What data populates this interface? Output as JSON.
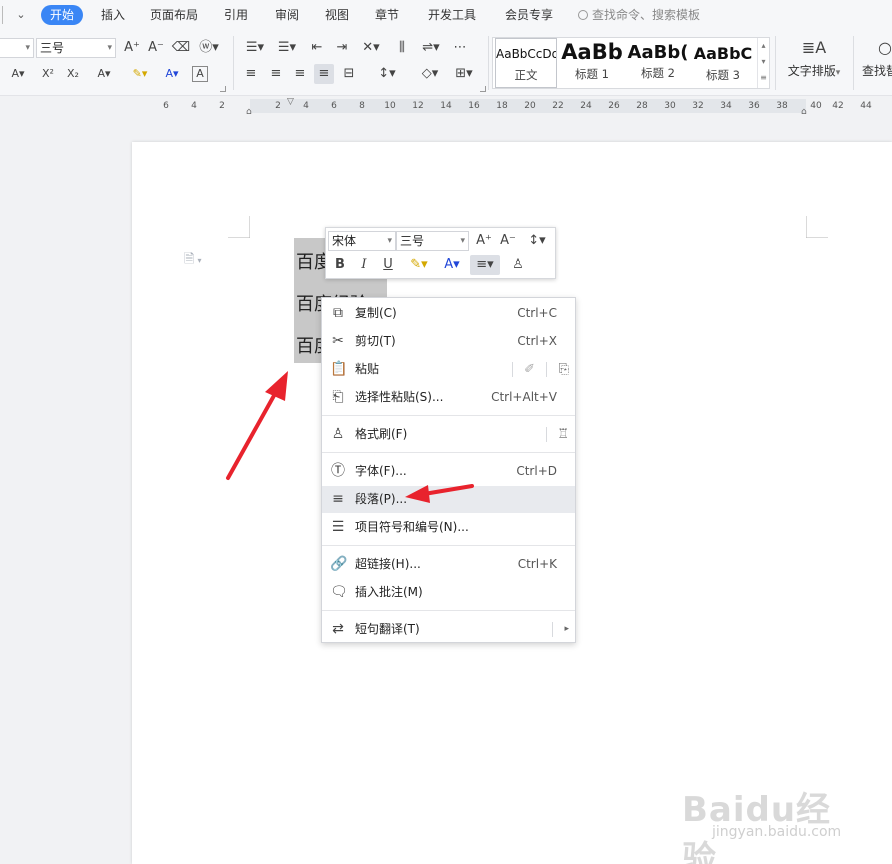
{
  "menu": {
    "tabs": [
      "开始",
      "插入",
      "页面布局",
      "引用",
      "审阅",
      "视图",
      "章节",
      "开发工具",
      "会员专享"
    ],
    "active_tab": "开始",
    "search_placeholder": "查找命令、搜索模板"
  },
  "toolbar": {
    "font_size": "三号",
    "styles": [
      {
        "preview": "AaBbCcDd",
        "name": "正文"
      },
      {
        "preview": "AaBb",
        "name": "标题 1"
      },
      {
        "preview": "AaBb(",
        "name": "标题 2"
      },
      {
        "preview": "AaBbC",
        "name": "标题 3"
      }
    ],
    "text_layout_label": "文字排版",
    "find_label": "查找替"
  },
  "ruler": {
    "numbers": [
      "6",
      "4",
      "2",
      "2",
      "4",
      "6",
      "8",
      "10",
      "12",
      "14",
      "16",
      "18",
      "20",
      "22",
      "24",
      "26",
      "28",
      "30",
      "32",
      "34",
      "36",
      "38",
      "40",
      "42",
      "44"
    ]
  },
  "document": {
    "lines": [
      "百度经验",
      "百度经验",
      "百度经验"
    ]
  },
  "mini_toolbar": {
    "font": "宋体",
    "size": "三号"
  },
  "context_menu": {
    "items": [
      {
        "icon": "copy-icon",
        "label": "复制(C)",
        "shortcut": "Ctrl+C"
      },
      {
        "icon": "cut-icon",
        "label": "剪切(T)",
        "shortcut": "Ctrl+X"
      },
      {
        "icon": "paste-icon",
        "label": "粘贴",
        "shortcut": ""
      },
      {
        "icon": "paste-special-icon",
        "label": "选择性粘贴(S)...",
        "shortcut": "Ctrl+Alt+V"
      },
      {
        "icon": "format-painter-icon",
        "label": "格式刷(F)",
        "shortcut": ""
      },
      {
        "icon": "font-icon",
        "label": "字体(F)...",
        "shortcut": "Ctrl+D"
      },
      {
        "icon": "paragraph-icon",
        "label": "段落(P)...",
        "shortcut": ""
      },
      {
        "icon": "bullets-icon",
        "label": "项目符号和编号(N)...",
        "shortcut": ""
      },
      {
        "icon": "hyperlink-icon",
        "label": "超链接(H)...",
        "shortcut": "Ctrl+K"
      },
      {
        "icon": "comment-icon",
        "label": "插入批注(M)",
        "shortcut": ""
      },
      {
        "icon": "translate-icon",
        "label": "短句翻译(T)",
        "shortcut": ""
      }
    ],
    "highlighted": "段落(P)..."
  },
  "colors": {
    "accent": "#3a86f5",
    "annotation_arrow": "#e8232d",
    "selection": "#c8c8c8",
    "menu_highlight": "#e8eaee"
  },
  "watermark": {
    "logo": "Baidu经验",
    "url": "jingyan.baidu.com"
  }
}
